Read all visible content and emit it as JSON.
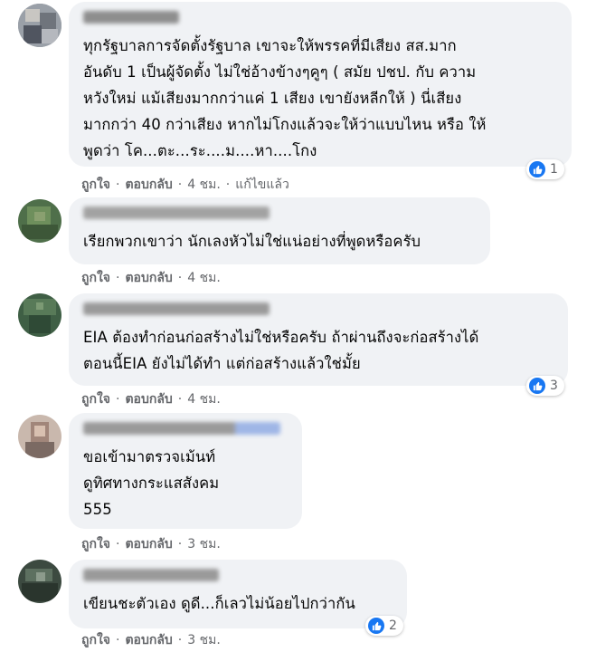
{
  "comments": [
    {
      "text": "ทุกรัฐบาลการจัดตั้งรัฐบาล เขาจะให้พรรคที่มีเสียง สส.มาก\nอันดับ 1 เป็นผู้จัดตั้ง ไม่ใช่อ้างข้างๆคูๆ ( สมัย ปชป. กับ ความ\nหวังใหม่ แม้เสียงมากกว่าแค่ 1 เสียง เขายังหลีกให้ ) นี่เสียง\nมากกว่า 40 กว่าเสียง หากไม่โกงแล้วจะให้ว่าแบบไหน หรือ ให้\nพูดว่า โค...ตะ...ระ....ม....หา....โกง",
      "like": "ถูกใจ",
      "reply": "ตอบกลับ",
      "time": "4 ชม.",
      "edited": "แก้ไขแล้ว",
      "reactions": "1"
    },
    {
      "text": "เรียกพวกเขาว่า นักเลงหัวไม่ใช่แน่อย่างที่พูดหรือครับ",
      "like": "ถูกใจ",
      "reply": "ตอบกลับ",
      "time": "4 ชม."
    },
    {
      "text": "EIA ต้องทำก่อนก่อสร้างไม่ใช่หรือครับ ถ้าผ่านถึงจะก่อสร้างได้\nตอนนี้EIA ยังไม่ได้ทำ แต่ก่อสร้างแล้วใช่มั้ย",
      "like": "ถูกใจ",
      "reply": "ตอบกลับ",
      "time": "4 ชม.",
      "reactions": "3"
    },
    {
      "text": "ขอเข้ามาตรวจเม้นท์\nดูทิศทางกระแสสังคม\n555",
      "like": "ถูกใจ",
      "reply": "ตอบกลับ",
      "time": "3 ชม."
    },
    {
      "text": "เขียนชะตัวเอง ดูดี...ก็เลวไม่น้อยไปกว่ากัน",
      "like": "ถูกใจ",
      "reply": "ตอบกลับ",
      "time": "3 ชม.",
      "reactions": "2"
    }
  ],
  "icons": {
    "reaction": "like-icon"
  },
  "colors": {
    "bubble": "#f0f2f5",
    "like_blue": "#1877f2",
    "meta_gray": "#65676b"
  }
}
